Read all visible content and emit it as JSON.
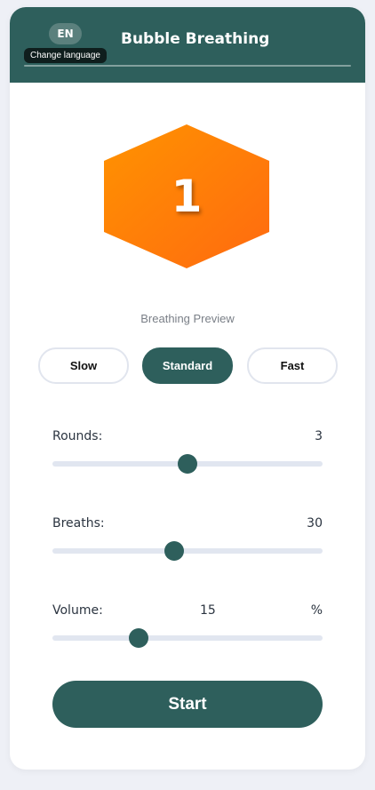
{
  "header": {
    "language_code": "EN",
    "language_tooltip": "Change language",
    "title": "Bubble Breathing"
  },
  "preview": {
    "count": "1",
    "label": "Breathing Preview",
    "shape_colors": [
      "#ff8c00",
      "#ff6f0f"
    ]
  },
  "speed": {
    "options": [
      "Slow",
      "Standard",
      "Fast"
    ],
    "selected": "Standard"
  },
  "sliders": {
    "rounds": {
      "label": "Rounds:",
      "value": "3",
      "fraction": 0.5
    },
    "breaths": {
      "label": "Breaths:",
      "value": "30",
      "fraction": 0.45
    },
    "volume": {
      "label": "Volume:",
      "value": "15",
      "unit": "%",
      "fraction": 0.32
    }
  },
  "actions": {
    "start_label": "Start"
  },
  "colors": {
    "primary": "#2e5f5c",
    "background": "#eef0f6"
  }
}
